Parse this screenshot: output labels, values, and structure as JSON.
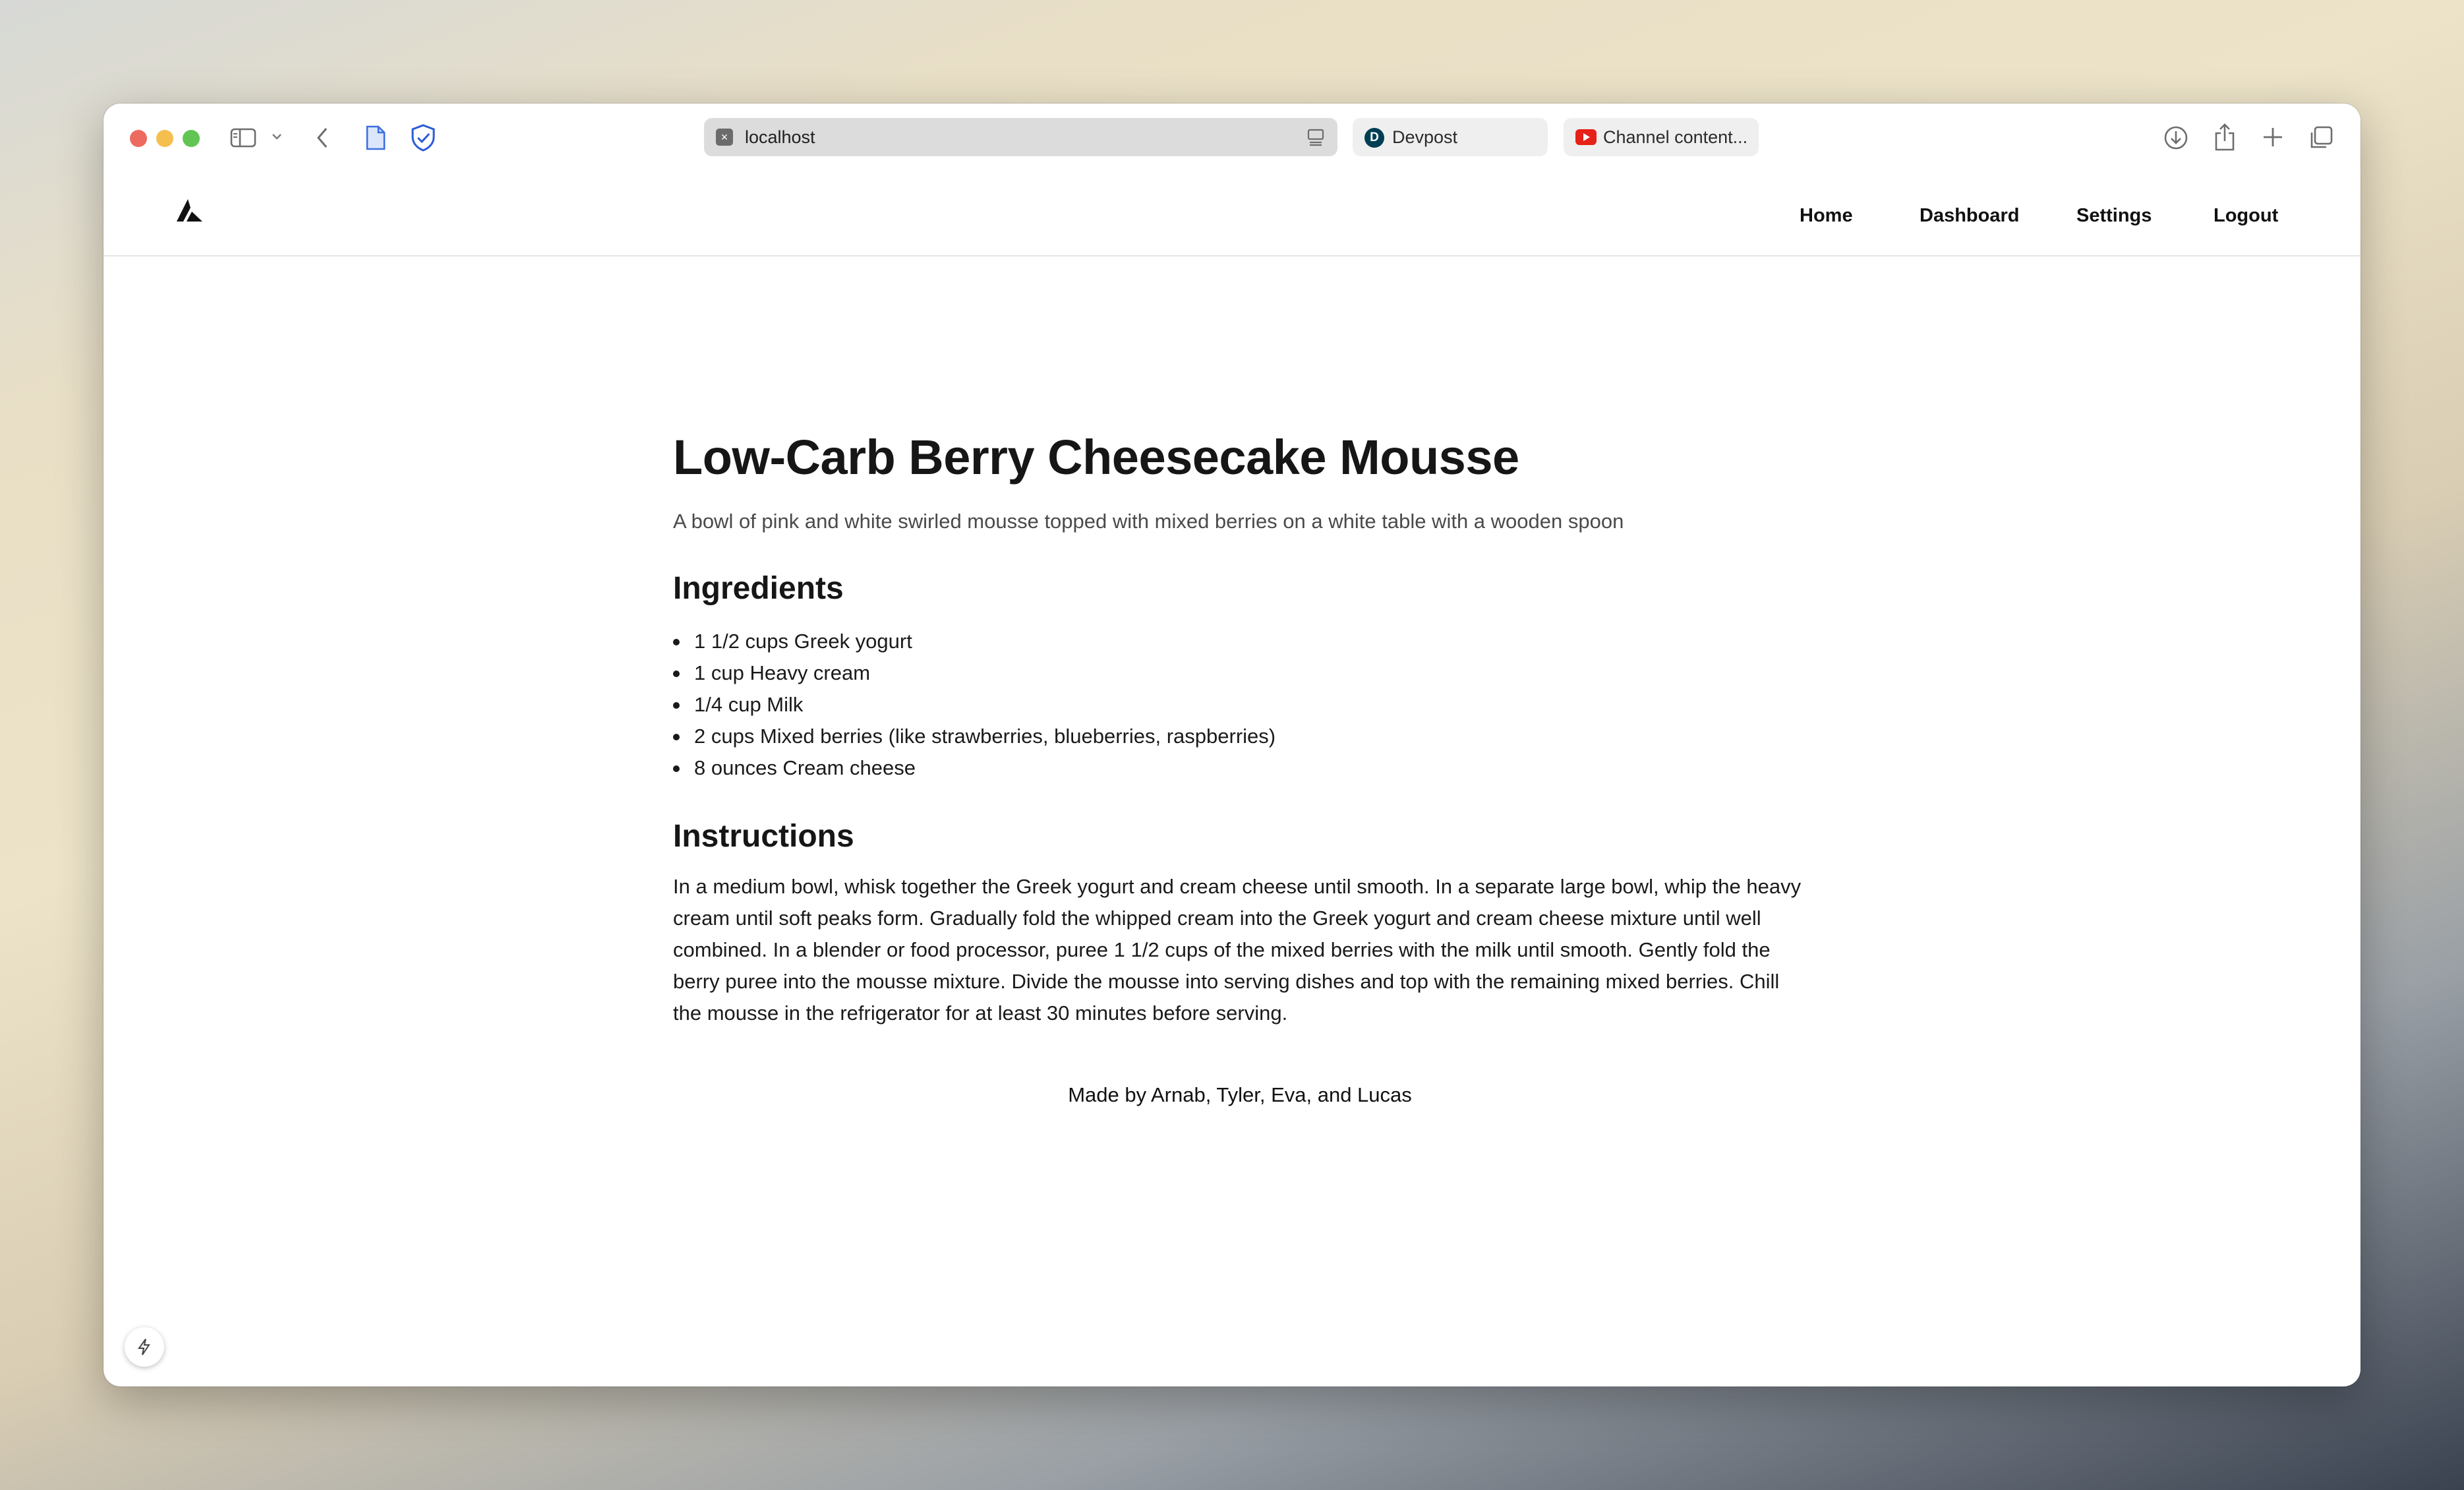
{
  "browser": {
    "tabs": [
      {
        "label": "localhost",
        "favicon": "localhost-favicon-icon",
        "active": true
      },
      {
        "label": "Devpost",
        "favicon": "devpost-favicon-icon",
        "active": false
      },
      {
        "label": "Channel content...",
        "favicon": "youtube-favicon-icon",
        "active": false
      }
    ],
    "devpost_letter": "D"
  },
  "nav": {
    "logo": "triangle-logo-icon",
    "links": [
      "Home",
      "Dashboard",
      "Settings",
      "Logout"
    ]
  },
  "recipe": {
    "title": "Low-Carb Berry Cheesecake Mousse",
    "image_alt": "A bowl of pink and white swirled mousse topped with mixed berries on a white table with a wooden spoon",
    "ingredients_heading": "Ingredients",
    "ingredients": [
      "1 1/2 cups Greek yogurt",
      "1 cup Heavy cream",
      "1/4 cup Milk",
      "2 cups Mixed berries (like strawberries, blueberries, raspberries)",
      "8 ounces Cream cheese"
    ],
    "instructions_heading": "Instructions",
    "instructions": "In a medium bowl, whisk together the Greek yogurt and cream cheese until smooth. In a separate large bowl, whip the heavy cream until soft peaks form. Gradually fold the whipped cream into the Greek yogurt and cream cheese mixture until well combined. In a blender or food processor, puree 1 1/2 cups of the mixed berries with the milk until smooth. Gently fold the berry puree into the mousse mixture. Divide the mousse into serving dishes and top with the remaining mixed berries. Chill the mousse in the refrigerator for at least 30 minutes before serving."
  },
  "footer": {
    "credit": "Made by Arnab, Tyler, Eva, and Lucas"
  },
  "colors": {
    "close": "#ed6a5e",
    "minimize": "#f5bf4f",
    "maximize": "#61c554",
    "shield_accent": "#2a5bd7",
    "page_accent": "#3b6fe0"
  }
}
